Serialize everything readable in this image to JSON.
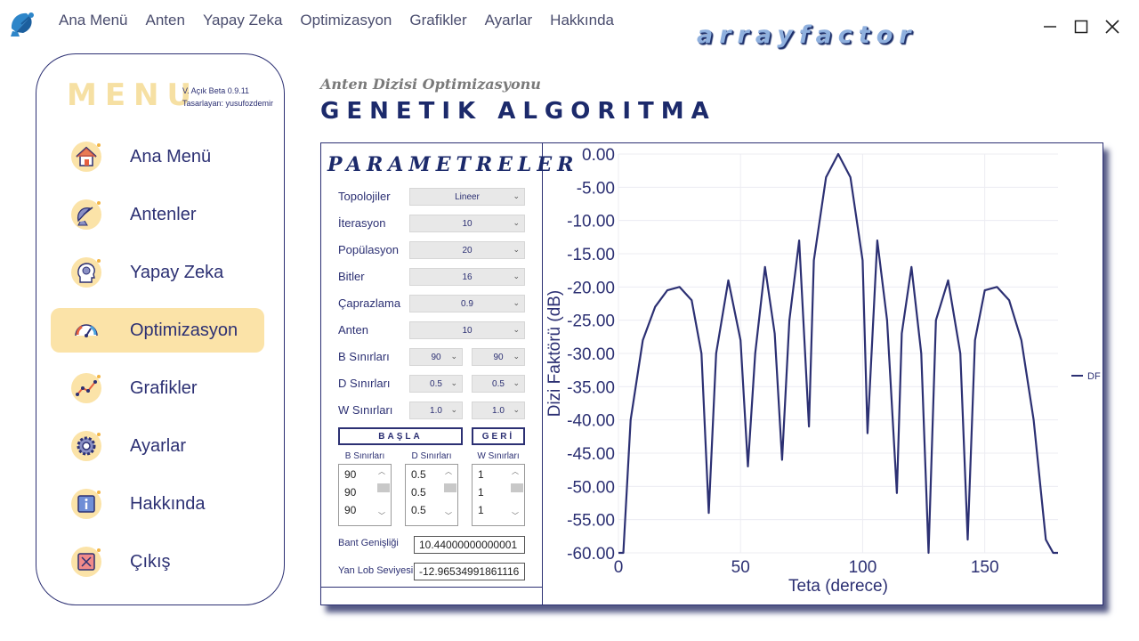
{
  "topnav": {
    "items": [
      "Ana Menü",
      "Anten",
      "Yapay Zeka",
      "Optimizasyon",
      "Grafikler",
      "Ayarlar",
      "Hakkında"
    ]
  },
  "brand": "arrayfactor",
  "sidebar": {
    "title": "MENU",
    "version": "V. Açık Beta 0.9.11",
    "author": "Tasarlayan: yusufozdemir",
    "items": [
      {
        "label": "Ana Menü",
        "icon": "home-icon"
      },
      {
        "label": "Antenler",
        "icon": "satellite-dish-icon"
      },
      {
        "label": "Yapay Zeka",
        "icon": "ai-brain-icon"
      },
      {
        "label": "Optimizasyon",
        "icon": "speed-gauge-icon"
      },
      {
        "label": "Grafikler",
        "icon": "line-chart-icon"
      },
      {
        "label": "Ayarlar",
        "icon": "gear-icon"
      },
      {
        "label": "Hakkında",
        "icon": "info-icon"
      },
      {
        "label": "Çıkış",
        "icon": "exit-icon"
      }
    ],
    "active_index": 3
  },
  "page": {
    "subtitle": "Anten Dizisi Optimizasyonu",
    "title": "GENETIK ALGORITMA"
  },
  "params": {
    "title": "PARAMETRELER",
    "rows": [
      {
        "label": "Topolojiler",
        "values": [
          "Lineer"
        ]
      },
      {
        "label": "İterasyon",
        "values": [
          "10"
        ]
      },
      {
        "label": "Popülasyon",
        "values": [
          "20"
        ]
      },
      {
        "label": "Bitler",
        "values": [
          "16"
        ]
      },
      {
        "label": "Çaprazlama",
        "values": [
          "0.9"
        ]
      },
      {
        "label": "Anten",
        "values": [
          "10"
        ]
      },
      {
        "label": "B Sınırları",
        "values": [
          "90",
          "90"
        ]
      },
      {
        "label": "D Sınırları",
        "values": [
          "0.5",
          "0.5"
        ]
      },
      {
        "label": "W Sınırları",
        "values": [
          "1.0",
          "1.0"
        ]
      }
    ],
    "start_button": "BAŞLA",
    "back_button": "GERİ",
    "lists": [
      {
        "header": "B Sınırları",
        "items": [
          "90",
          "90",
          "90"
        ]
      },
      {
        "header": "D Sınırları",
        "items": [
          "0.5",
          "0.5",
          "0.5"
        ]
      },
      {
        "header": "W Sınırları",
        "items": [
          "1",
          "1",
          "1"
        ]
      }
    ],
    "bandwidth_label": "Bant Genişliği",
    "bandwidth_value": "10.44000000000001",
    "sidelobe_label": "Yan Lob Seviyesi",
    "sidelobe_value": "-12.96534991861116"
  },
  "chart_data": {
    "type": "line",
    "xlabel": "Teta (derece)",
    "ylabel": "Dizi Faktörü (dB)",
    "xlim": [
      0,
      180
    ],
    "ylim": [
      -60,
      0
    ],
    "xticks": [
      "0",
      "50",
      "100",
      "150"
    ],
    "yticks": [
      "0.00",
      "-5.00",
      "-10.00",
      "-15.00",
      "-20.00",
      "-25.00",
      "-30.00",
      "-35.00",
      "-40.00",
      "-45.00",
      "-50.00",
      "-55.00",
      "-60.00"
    ],
    "grid": true,
    "legend": "right",
    "color": "#2c3073",
    "series": [
      {
        "name": "DF",
        "x": [
          0,
          2,
          5,
          10,
          15,
          20,
          25,
          30,
          34,
          37,
          40,
          45,
          50,
          53,
          56,
          60,
          64,
          67,
          70,
          74,
          78,
          80,
          85,
          90,
          95,
          100,
          102,
          106,
          110,
          114,
          116,
          120,
          124,
          127,
          130,
          135,
          140,
          143,
          146,
          150,
          155,
          160,
          165,
          170,
          175,
          178,
          180
        ],
        "y": [
          -60,
          -60,
          -40,
          -28,
          -23,
          -20.5,
          -20,
          -22,
          -30,
          -54,
          -30,
          -19,
          -28,
          -47,
          -30,
          -17,
          -27,
          -46,
          -25,
          -13,
          -41,
          -16,
          -3.5,
          0,
          -3.5,
          -16,
          -42,
          -13,
          -25,
          -51,
          -27,
          -17,
          -30,
          -60,
          -25,
          -19,
          -30,
          -58,
          -28,
          -20.5,
          -20,
          -22,
          -28,
          -40,
          -58,
          -60,
          -60
        ]
      }
    ]
  }
}
